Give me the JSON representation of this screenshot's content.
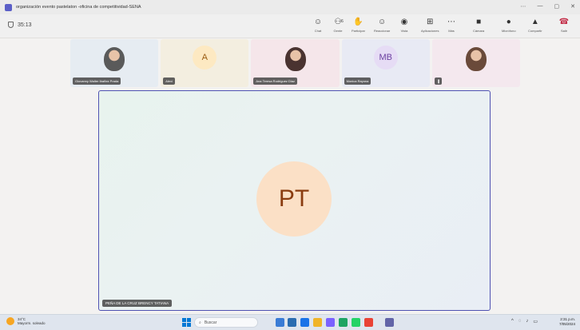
{
  "window": {
    "title": "organización evento pastelaton -oficina de competitividad-SENA",
    "controls": [
      "⋯",
      "—",
      "▢",
      "✕"
    ]
  },
  "toolbar": {
    "timer": "35:13",
    "buttons": [
      {
        "label": "Chat",
        "icon": "chat-icon",
        "glyph": "☺"
      },
      {
        "label": "Gente",
        "icon": "people-icon",
        "glyph": "⚇",
        "count": "6"
      },
      {
        "label": "Participar",
        "icon": "raise-hand-icon",
        "glyph": "✋"
      },
      {
        "label": "Reaccionar",
        "icon": "react-icon",
        "glyph": "☺"
      },
      {
        "label": "Vista",
        "icon": "view-icon",
        "glyph": "◉"
      },
      {
        "label": "Aplicaciones",
        "icon": "apps-icon",
        "glyph": "⊞"
      },
      {
        "label": "Más",
        "icon": "more-icon",
        "glyph": "⋯"
      },
      {
        "label": "Cámara",
        "icon": "camera-off-icon",
        "glyph": "■"
      },
      {
        "label": "Micrófono",
        "icon": "microphone-icon",
        "glyph": "●"
      },
      {
        "label": "Compartir",
        "icon": "share-icon",
        "glyph": "▲"
      },
      {
        "label": "Salir",
        "icon": "leave-icon",
        "glyph": "☎"
      }
    ]
  },
  "participants": [
    {
      "name": "Giovanny Walter Ibañez Prada",
      "type": "photo",
      "bg": "#e6ecf2",
      "photo_color": "#5a5a5a"
    },
    {
      "name": "Alexi",
      "type": "initials",
      "initials": "A",
      "bg": "#f3eee0",
      "avatar_color": "#fde9c2",
      "text_color": "#9a5a10"
    },
    {
      "name": "Ana Teresa Rodriguez Diaz",
      "type": "photo",
      "bg": "#f5e6ea",
      "photo_color": "#4a3330"
    },
    {
      "name": "Monica Rayona",
      "type": "initials",
      "initials": "MB",
      "bg": "#e8eaf4",
      "avatar_color": "#e6dcf5",
      "text_color": "#6b3fa0"
    },
    {
      "name": "",
      "type": "photo",
      "bg": "#f4e8ee",
      "photo_color": "#6a4a3a"
    }
  ],
  "stage": {
    "initials": "PT",
    "name": "PEÑA DE LA CRUZ BRENCY TATIANA"
  },
  "taskbar": {
    "weather_temp": "34°C",
    "weather_desc": "Mayorm. soleado",
    "search_placeholder": "Buscar",
    "time": "2:31 p.m.",
    "date": "7/05/2024",
    "apps": [
      "#3a7bd5",
      "#2b6cb0",
      "#1a73e8",
      "#f0b429",
      "#7b61ff",
      "#1fa463",
      "#25d366",
      "#e94235",
      "#6264a7"
    ]
  },
  "colors": {
    "accent": "#4f52b2",
    "leave": "#c4314b"
  }
}
